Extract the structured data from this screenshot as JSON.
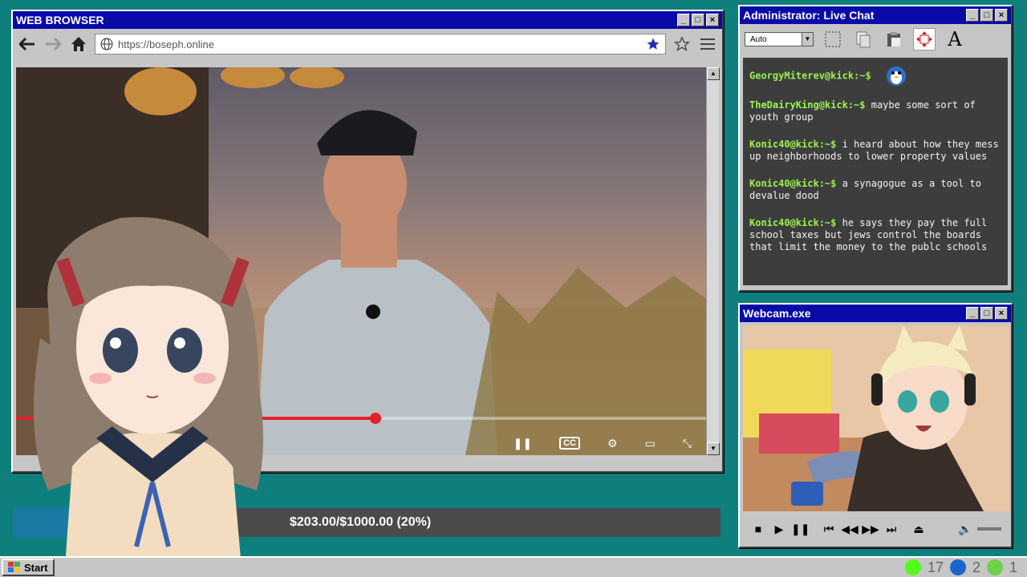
{
  "browser": {
    "title": "WEB BROWSER",
    "url": "https://boseph.online",
    "video_progress": 0.52
  },
  "chat": {
    "title": "Administrator: Live Chat",
    "font_select": "Auto",
    "messages": [
      {
        "user": "GeorgyMiterev@kick:~$",
        "text": ""
      },
      {
        "user": "TheDairyKing@kick:~$",
        "text": " maybe some sort of youth group"
      },
      {
        "user": "Konic40@kick:~$",
        "text": " i heard about how they mess up neighborhoods to lower property values"
      },
      {
        "user": "Konic40@kick:~$",
        "text": " a synagogue as a tool to devalue dood"
      },
      {
        "user": "Konic40@kick:~$",
        "text": " he says they pay the full school taxes but jews control the boards that limit the money to the publc schools"
      }
    ]
  },
  "webcam": {
    "title": "Webcam.exe"
  },
  "donation": {
    "text": "$203.00/$1000.00 (20%)",
    "progress": 0.2
  },
  "taskbar": {
    "start_label": "Start",
    "tray": [
      {
        "icon": "kick-icon",
        "count": "17",
        "color": "#53fc18"
      },
      {
        "icon": "moon-icon",
        "count": "2",
        "color": "#1a66cc"
      },
      {
        "icon": "play-icon",
        "count": "1",
        "color": "#6fd14a"
      }
    ]
  }
}
